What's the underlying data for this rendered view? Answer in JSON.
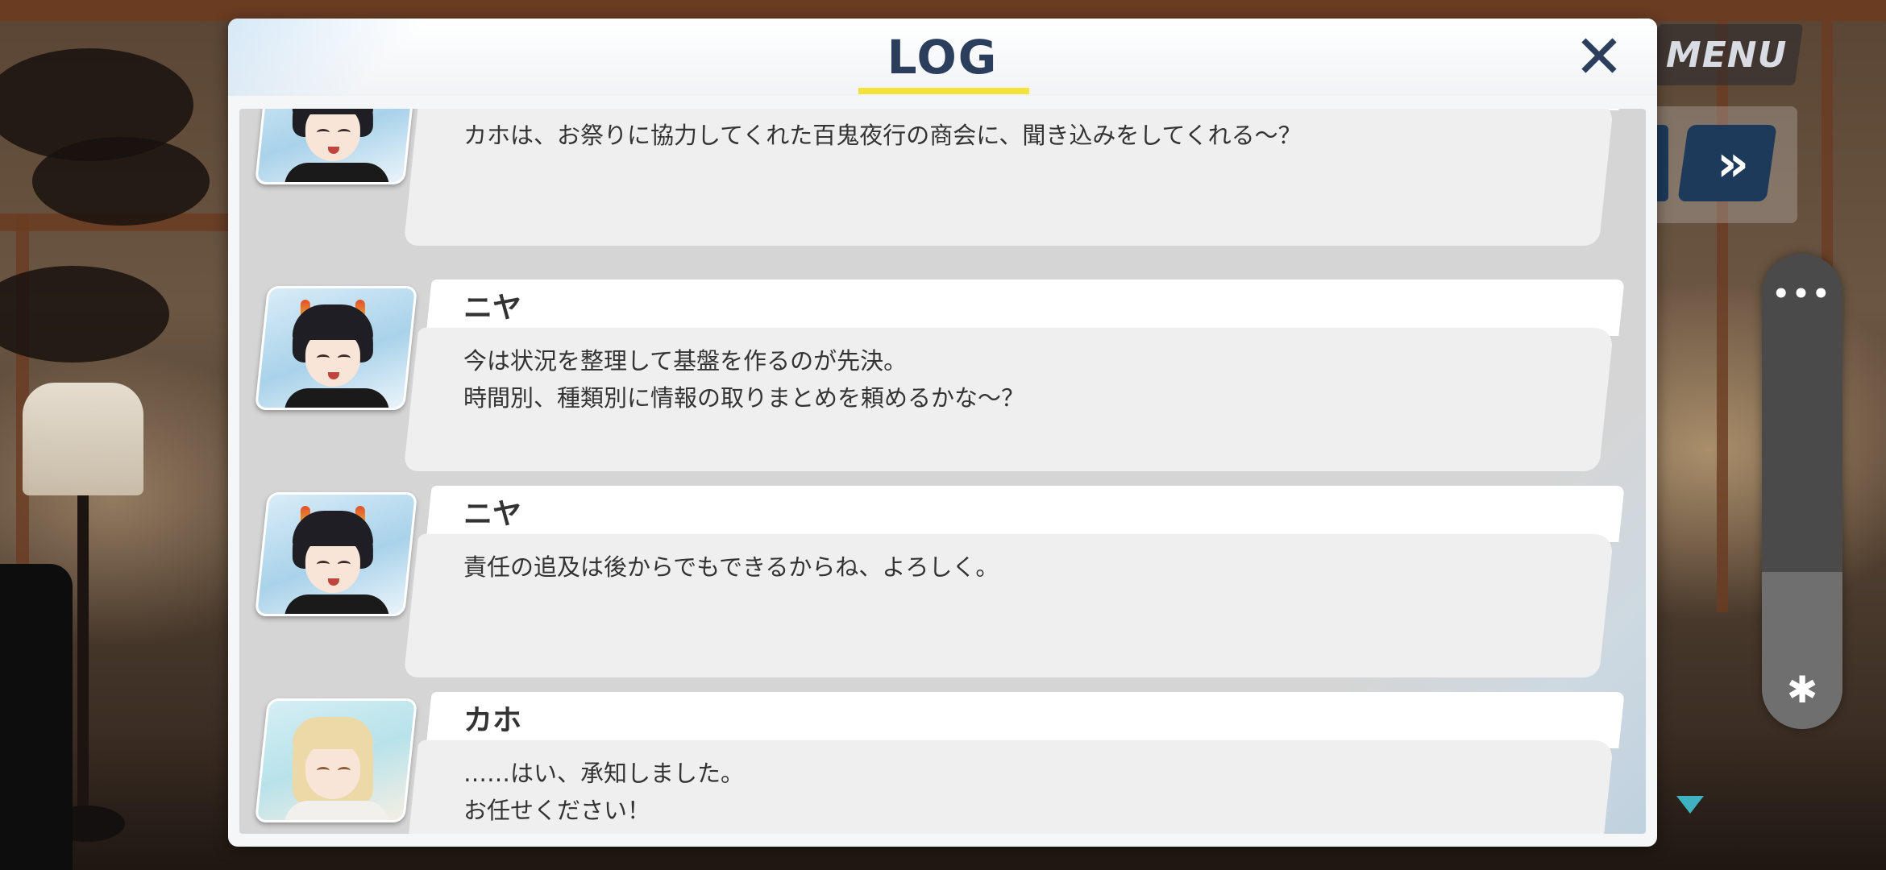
{
  "game_ui": {
    "menu_label": "MENU",
    "fast_forward_glyph": "»",
    "panel_dots": "•••",
    "bluetooth_glyph": "✱"
  },
  "log": {
    "title": "LOG",
    "close_glyph": "✕",
    "entries": [
      {
        "speaker": "",
        "portrait": "niya-portrait",
        "text": "カホは、お祭りに協力してくれた百鬼夜行の商会に、聞き込みをしてくれる～？"
      },
      {
        "speaker": "ニヤ",
        "portrait": "niya-portrait",
        "text": "今は状況を整理して基盤を作るのが先決。\n時間別、種類別に情報の取りまとめを頼めるかな～？"
      },
      {
        "speaker": "ニヤ",
        "portrait": "niya-portrait",
        "text": "責任の追及は後からでもできるからね、よろしく。"
      },
      {
        "speaker": "カホ",
        "portrait": "kaho-portrait",
        "text": "……はい、承知しました。\nお任せください！"
      }
    ]
  },
  "colors": {
    "title_text": "#2b3f5c",
    "title_underline": "#f3e23a",
    "fast_forward_bg": "#1d3a5a",
    "scroll_arrow": "#3fb2c2"
  }
}
